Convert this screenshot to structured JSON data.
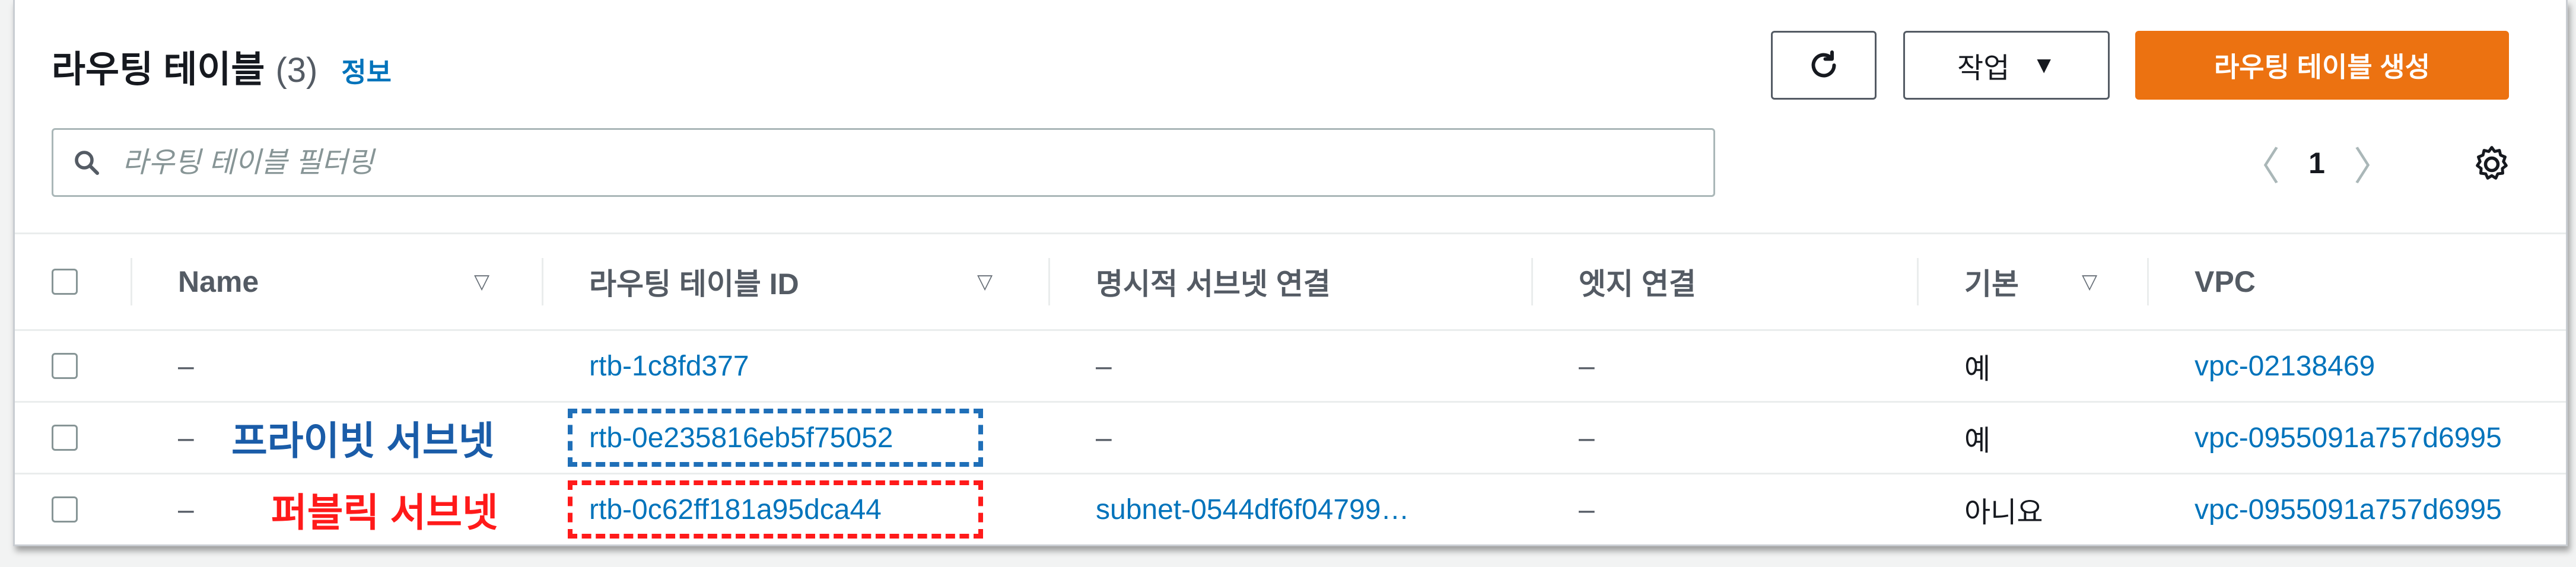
{
  "header": {
    "title": "라우팅 테이블",
    "count": "(3)",
    "info_link": "정보"
  },
  "buttons": {
    "refresh_icon": "refresh-icon",
    "actions_label": "작업",
    "create_label": "라우팅 테이블 생성"
  },
  "search": {
    "placeholder": "라우팅 테이블 필터링"
  },
  "pagination": {
    "current_page": "1",
    "prev": "〈",
    "next": "〉"
  },
  "table": {
    "columns": {
      "name": "Name",
      "route_table_id": "라우팅 테이블 ID",
      "explicit_subnet": "명시적 서브넷 연결",
      "edge": "엣지 연결",
      "main": "기본",
      "vpc": "VPC"
    },
    "sort_icon": "▽",
    "rows": [
      {
        "name": "–",
        "route_table_id": "rtb-1c8fd377",
        "explicit_subnet": "–",
        "edge": "–",
        "main": "예",
        "vpc": "vpc-02138469"
      },
      {
        "name": "–",
        "route_table_id": "rtb-0e235816eb5f75052",
        "explicit_subnet": "–",
        "edge": "–",
        "main": "예",
        "vpc": "vpc-0955091a757d6995"
      },
      {
        "name": "–",
        "route_table_id": "rtb-0c62ff181a95dca44",
        "explicit_subnet": "subnet-0544df6f04799…",
        "edge": "–",
        "main": "아니요",
        "vpc": "vpc-0955091a757d6995"
      }
    ]
  },
  "annotations": {
    "private_subnet": "프라이빗 서브넷",
    "public_subnet": "퍼블릭 서브넷"
  },
  "colors": {
    "primary_button": "#ec7211",
    "link": "#0073bb",
    "annotation_blue": "#1a5ca8",
    "annotation_red": "#ff1a1a"
  }
}
